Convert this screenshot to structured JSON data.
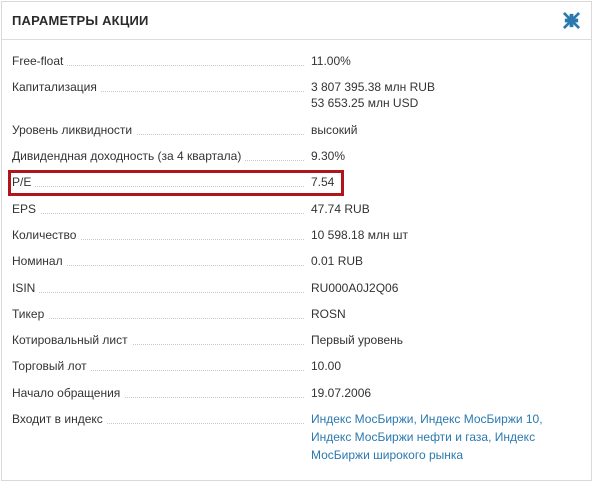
{
  "panel": {
    "title": "ПАРАМЕТРЫ АКЦИИ",
    "collapse_icon": "compress-arrows-icon",
    "accent_color": "#2a79b0",
    "highlight_color": "#b0151b"
  },
  "rows": [
    {
      "label": "Free-float",
      "value": "11.00%"
    },
    {
      "label": "Капитализация",
      "value_lines": [
        "3 807 395.38 млн RUB",
        "53 653.25 млн USD"
      ]
    },
    {
      "label": "Уровень ликвидности",
      "value": "высокий"
    },
    {
      "label": "Дивидендная доходность (за 4 квартала)",
      "value": "9.30%"
    },
    {
      "label": "P/E",
      "value": "7.54",
      "highlighted": true
    },
    {
      "label": "EPS",
      "value": "47.74 RUB"
    },
    {
      "label": "Количество",
      "value": "10 598.18 млн шт"
    },
    {
      "label": "Номинал",
      "value": "0.01 RUB"
    },
    {
      "label": "ISIN",
      "value": "RU000A0J2Q06"
    },
    {
      "label": "Тикер",
      "value": "ROSN"
    },
    {
      "label": "Котировальный лист",
      "value": "Первый уровень"
    },
    {
      "label": "Торговый лот",
      "value": "10.00"
    },
    {
      "label": "Начало обращения",
      "value": "19.07.2006"
    },
    {
      "label": "Входит в индекс",
      "index_links": [
        "Индекс МосБиржи",
        "Индекс МосБиржи 10",
        "Индекс МосБиржи нефти и газа",
        "Индекс МосБиржи широкого рынка"
      ]
    }
  ]
}
